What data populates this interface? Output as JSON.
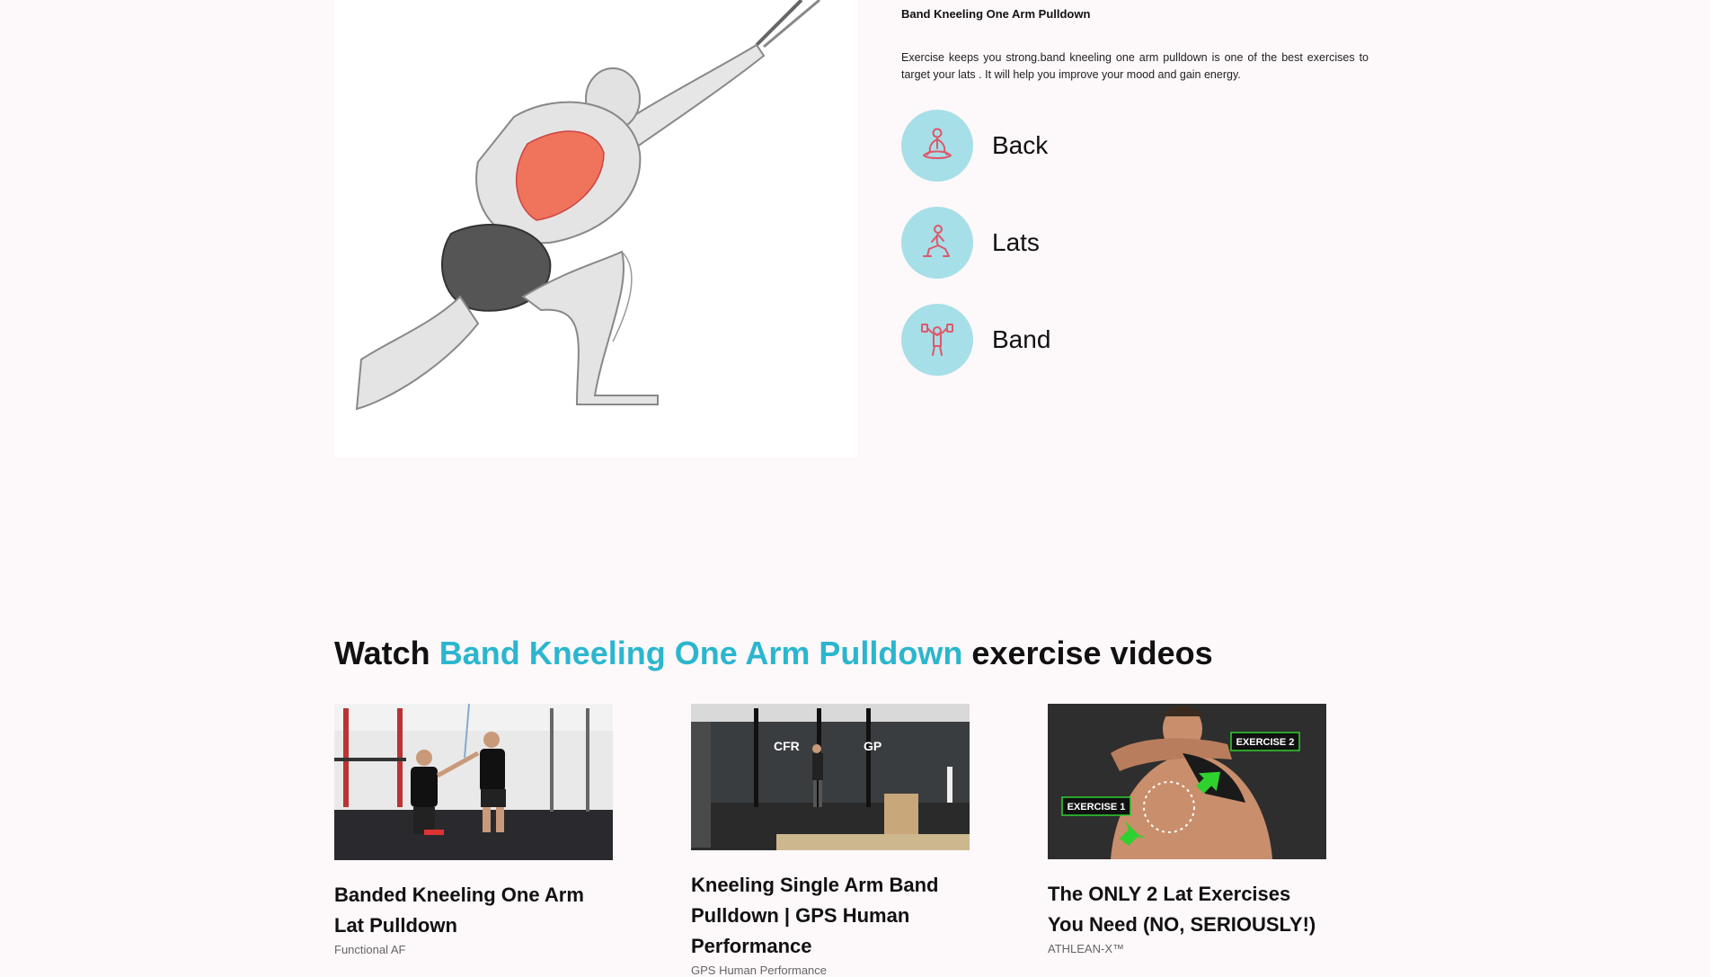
{
  "exercise": {
    "title": "Band Kneeling One Arm Pulldown",
    "description": "Exercise keeps you strong.band kneeling one arm pulldown is one of the best exercises to target your lats . It will help you improve your mood and gain energy.",
    "tags": [
      {
        "label": "Back",
        "icon": "meditation-pose-icon"
      },
      {
        "label": "Lats",
        "icon": "lunge-pose-icon"
      },
      {
        "label": "Band",
        "icon": "dumbbell-lift-icon"
      }
    ]
  },
  "colors": {
    "accent": "#2bb6cf",
    "tag_circle": "#a6dfe8",
    "icon_stroke": "#e0566a",
    "page_bg": "#fdf8f9"
  },
  "videos": {
    "heading_prefix": "Watch",
    "heading_accent": "Band Kneeling One Arm Pulldown",
    "heading_suffix": "exercise videos",
    "items": [
      {
        "title": "Banded Kneeling One Arm Lat Pulldown",
        "channel": "Functional AF"
      },
      {
        "title": "Kneeling Single Arm Band Pulldown | GPS Human Performance",
        "channel": "GPS Human Performance",
        "thumb_logos": [
          "CFR",
          "GP"
        ]
      },
      {
        "title": "The ONLY 2 Lat Exercises You Need (NO, SERIOUSLY!)",
        "channel": "ATHLEAN-X™",
        "thumb_badges": [
          "EXERCISE 2",
          "EXERCISE 1"
        ]
      }
    ]
  }
}
